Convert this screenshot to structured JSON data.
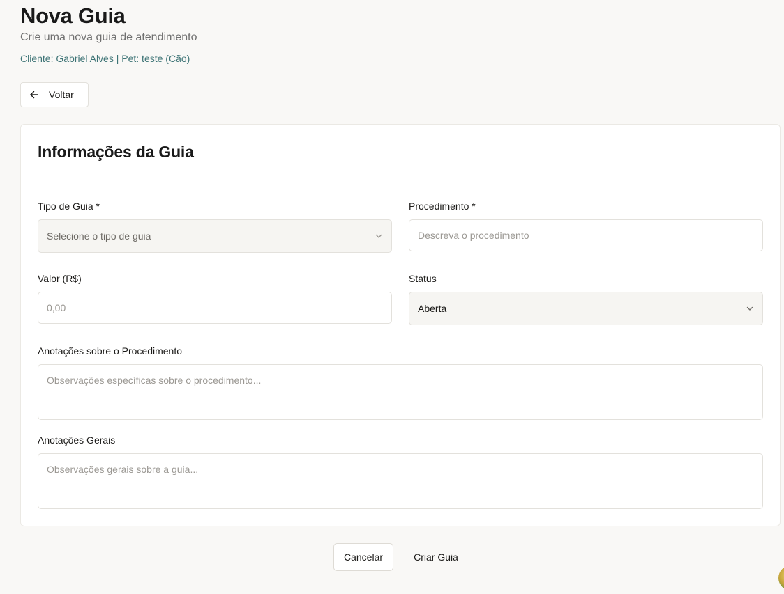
{
  "header": {
    "title": "Nova Guia",
    "subtitle": "Crie uma nova guia de atendimento",
    "client_line": "Cliente: Gabriel Alves | Pet: teste (Cão)"
  },
  "back_button": {
    "label": "Voltar",
    "icon": "arrow-left-icon"
  },
  "form": {
    "title": "Informações da Guia",
    "tipo_guia": {
      "label": "Tipo de Guia *",
      "placeholder": "Selecione o tipo de guia",
      "icon": "chevron-down-icon"
    },
    "procedimento": {
      "label": "Procedimento *",
      "placeholder": "Descreva o procedimento",
      "value": ""
    },
    "valor": {
      "label": "Valor (R$)",
      "placeholder": "0,00",
      "value": ""
    },
    "status": {
      "label": "Status",
      "value": "Aberta",
      "icon": "chevron-down-icon"
    },
    "anotacoes_procedimento": {
      "label": "Anotações sobre o Procedimento",
      "placeholder": "Observações específicas sobre o procedimento...",
      "value": ""
    },
    "anotacoes_gerais": {
      "label": "Anotações Gerais",
      "placeholder": "Observações gerais sobre a guia...",
      "value": ""
    }
  },
  "actions": {
    "cancel_label": "Cancelar",
    "create_label": "Criar Guia"
  },
  "colors": {
    "background": "#f9f8f6",
    "accent_text": "#3e7476",
    "card": "#ffffff",
    "border": "#e3e1dc"
  }
}
